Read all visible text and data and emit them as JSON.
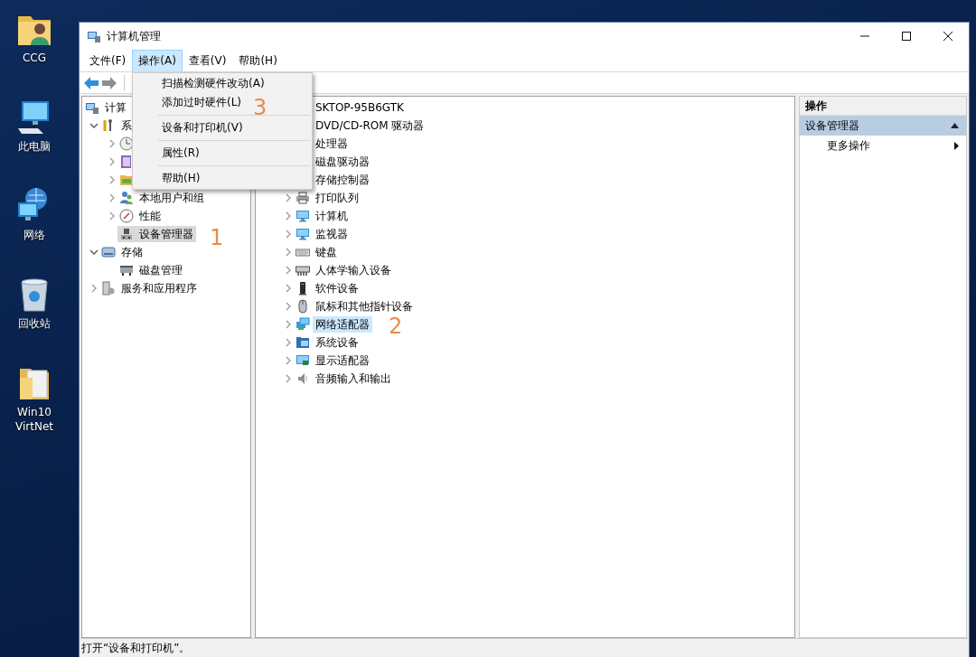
{
  "desktop": {
    "icons": [
      {
        "label": "CCG"
      },
      {
        "label": "此电脑"
      },
      {
        "label": "网络"
      },
      {
        "label": "回收站"
      },
      {
        "label": "Win10 VirtNet"
      }
    ]
  },
  "window": {
    "title": "计算机管理",
    "menu": [
      {
        "label": "文件(F)",
        "selected": false
      },
      {
        "label": "操作(A)",
        "selected": true
      },
      {
        "label": "查看(V)",
        "selected": false
      },
      {
        "label": "帮助(H)",
        "selected": false
      }
    ],
    "left_tree": [
      {
        "label": "计算",
        "selected": false,
        "children": [
          {
            "label": "系",
            "expanded": true,
            "selected": false,
            "children": [
              {
                "expanded": false
              },
              {
                "expanded": false
              },
              {
                "expanded": false
              },
              {
                "label": "本地用户和组",
                "expanded": false,
                "selected": false
              },
              {
                "label": "性能",
                "expanded": false,
                "selected": false
              },
              {
                "label": "设备管理器",
                "selected": true
              }
            ]
          },
          {
            "label": "存储",
            "expanded": true,
            "selected": false,
            "children": [
              {
                "label": "磁盘管理",
                "selected": false
              }
            ]
          },
          {
            "label": "服务和应用程序",
            "expanded": false,
            "selected": false
          }
        ]
      }
    ],
    "center_tree": [
      {
        "label": "SKTOP-95B6GTK",
        "selected": false,
        "children": [
          {
            "label": "DVD/CD-ROM 驱动器",
            "selected": false
          },
          {
            "label": "处理器",
            "selected": false
          },
          {
            "label": "磁盘驱动器",
            "selected": false
          },
          {
            "label": "存储控制器",
            "selected": false
          },
          {
            "label": "打印队列",
            "expanded": false,
            "selected": false
          },
          {
            "label": "计算机",
            "expanded": false,
            "selected": false
          },
          {
            "label": "监视器",
            "expanded": false,
            "selected": false
          },
          {
            "label": "键盘",
            "expanded": false,
            "selected": false
          },
          {
            "label": "人体学输入设备",
            "expanded": false,
            "selected": false
          },
          {
            "label": "软件设备",
            "expanded": false,
            "selected": false
          },
          {
            "label": "鼠标和其他指针设备",
            "expanded": false,
            "selected": false
          },
          {
            "label": "网络适配器",
            "expanded": false,
            "selected": true
          },
          {
            "label": "系统设备",
            "expanded": false,
            "selected": false
          },
          {
            "label": "显示适配器",
            "expanded": false,
            "selected": false
          },
          {
            "label": "音频输入和输出",
            "expanded": false,
            "selected": false
          }
        ]
      }
    ],
    "actions": {
      "header": "操作",
      "section": {
        "label": "设备管理器",
        "expanded": true
      },
      "items": [
        {
          "label": "更多操作"
        }
      ]
    },
    "context_menu": [
      {
        "kind": "item",
        "label": "扫描检测硬件改动(A)"
      },
      {
        "kind": "item",
        "label": "添加过时硬件(L)"
      },
      {
        "kind": "separator"
      },
      {
        "kind": "item",
        "label": "设备和打印机(V)"
      },
      {
        "kind": "separator"
      },
      {
        "kind": "item",
        "label": "属性(R)"
      },
      {
        "kind": "separator"
      },
      {
        "kind": "item",
        "label": "帮助(H)"
      }
    ],
    "status_bar": "打开“设备和打印机”。",
    "annotations": [
      {
        "label": "1"
      },
      {
        "label": "2"
      },
      {
        "label": "3"
      }
    ]
  }
}
